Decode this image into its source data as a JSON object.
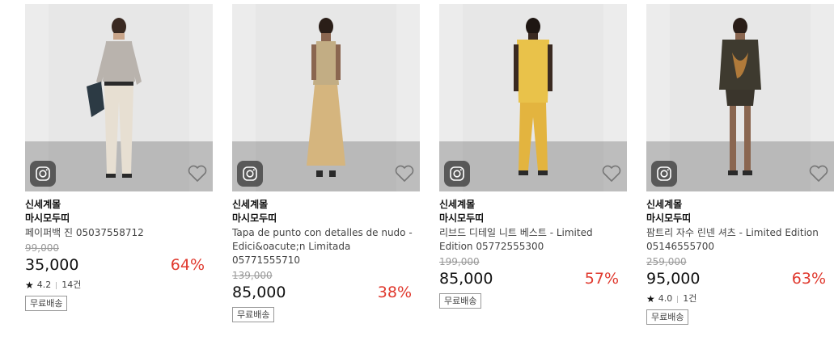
{
  "products": [
    {
      "brand": "신세계몰",
      "seller": "마시모두띠",
      "name": "페이퍼백 진 05037558712",
      "original_price": "99,000",
      "price": "35,000",
      "discount": "64%",
      "rating": "4.2",
      "review_count": "14건",
      "shipping": "무료배송",
      "outfit_color": "#b9b3ad",
      "pants_color": "#e7dfd2"
    },
    {
      "brand": "신세계몰",
      "seller": "마시모두띠",
      "name": "Tapa de punto con detalles de nudo - Edici&oacute;n Limitada 05771555710",
      "original_price": "139,000",
      "price": "85,000",
      "discount": "38%",
      "shipping": "무료배송",
      "outfit_color": "#c2ad84",
      "pants_color": "#d5b57e"
    },
    {
      "brand": "신세계몰",
      "seller": "마시모두띠",
      "name": "리브드 디테일 니트 베스트 - Limited Edition 05772555300",
      "original_price": "199,000",
      "price": "85,000",
      "discount": "57%",
      "shipping": "무료배송",
      "outfit_color": "#e9c24a",
      "pants_color": "#e3b43f"
    },
    {
      "brand": "신세계몰",
      "seller": "마시모두띠",
      "name": "팜트리 자수 린넨 셔츠 - Limited Edition 05146555700",
      "original_price": "259,000",
      "price": "95,000",
      "discount": "63%",
      "rating": "4.0",
      "review_count": "1건",
      "shipping": "무료배송",
      "outfit_color": "#3e3a2f",
      "pants_color": "#3a352c"
    }
  ]
}
